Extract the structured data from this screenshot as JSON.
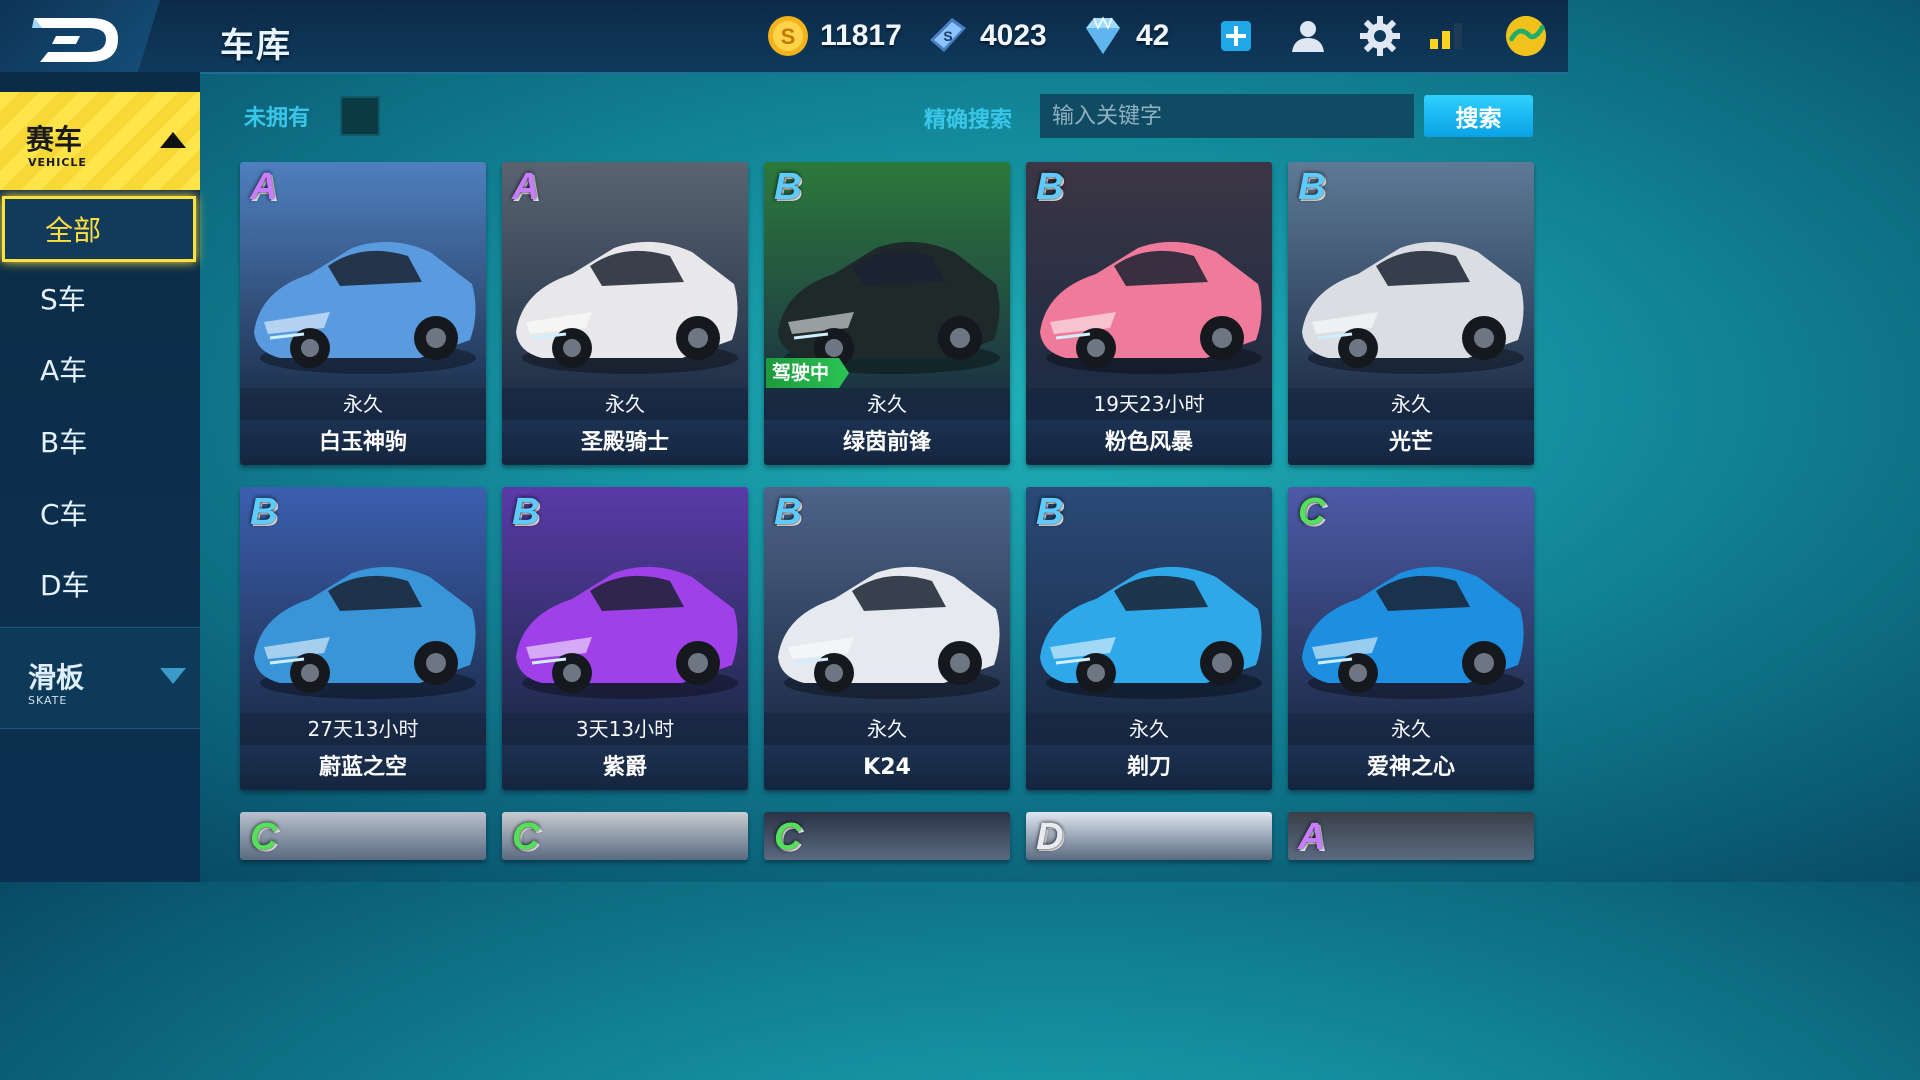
{
  "header": {
    "title": "车库",
    "gold": "11817",
    "coupon": "4023",
    "diamond": "42"
  },
  "sidebar": {
    "category": {
      "label_zh": "赛车",
      "label_en": "VEHICLE"
    },
    "items": [
      {
        "label": "全部",
        "active": true
      },
      {
        "label": "S车"
      },
      {
        "label": "A车"
      },
      {
        "label": "B车"
      },
      {
        "label": "C车"
      },
      {
        "label": "D车"
      }
    ],
    "skate": {
      "label_zh": "滑板",
      "label_en": "SKATE"
    }
  },
  "filter": {
    "not_owned_label": "未拥有",
    "search_label": "精确搜索",
    "search_placeholder": "输入关键字",
    "search_button": "搜索"
  },
  "cars": [
    {
      "grade": "A",
      "duration": "永久",
      "name": "白玉神驹",
      "color": "#5a9be0",
      "bg": "#4f7fbf"
    },
    {
      "grade": "A",
      "duration": "永久",
      "name": "圣殿骑士",
      "color": "#e8e8ea",
      "bg": "#5a6470"
    },
    {
      "grade": "B",
      "duration": "永久",
      "name": "绿茵前锋",
      "color": "#1e2a2a",
      "bg": "#2c7a3c",
      "tag": "驾驶中"
    },
    {
      "grade": "B",
      "duration": "19天23小时",
      "name": "粉色风暴",
      "color": "#f07a9a",
      "bg": "#3c3644"
    },
    {
      "grade": "B",
      "duration": "永久",
      "name": "光芒",
      "color": "#dadde2",
      "bg": "#5e7a96"
    },
    {
      "grade": "B",
      "duration": "27天13小时",
      "name": "蔚蓝之空",
      "color": "#3a94d8",
      "bg": "#3c5fb0"
    },
    {
      "grade": "B",
      "duration": "3天13小时",
      "name": "紫爵",
      "color": "#a040e8",
      "bg": "#5a3aa8"
    },
    {
      "grade": "B",
      "duration": "永久",
      "name": "K24",
      "color": "#e6e9ee",
      "bg": "#4e6488"
    },
    {
      "grade": "B",
      "duration": "永久",
      "name": "剃刀",
      "color": "#2fa8ea",
      "bg": "#2a4a78"
    },
    {
      "grade": "C",
      "duration": "永久",
      "name": "爱神之心",
      "color": "#1e8ee0",
      "bg": "#4e5aa8"
    }
  ],
  "partial_cars": [
    {
      "grade": "C",
      "bg": "#b8c0cc"
    },
    {
      "grade": "C",
      "bg": "#c8ccd2"
    },
    {
      "grade": "C",
      "bg": "#2a3248"
    },
    {
      "grade": "D",
      "bg": "#dfe6f0"
    },
    {
      "grade": "A",
      "bg": "#3a4048"
    }
  ],
  "grade_colors": {
    "A": "#c77dff",
    "B": "#5ecbff",
    "C": "#54e05a",
    "D": "#e8ecf2"
  }
}
